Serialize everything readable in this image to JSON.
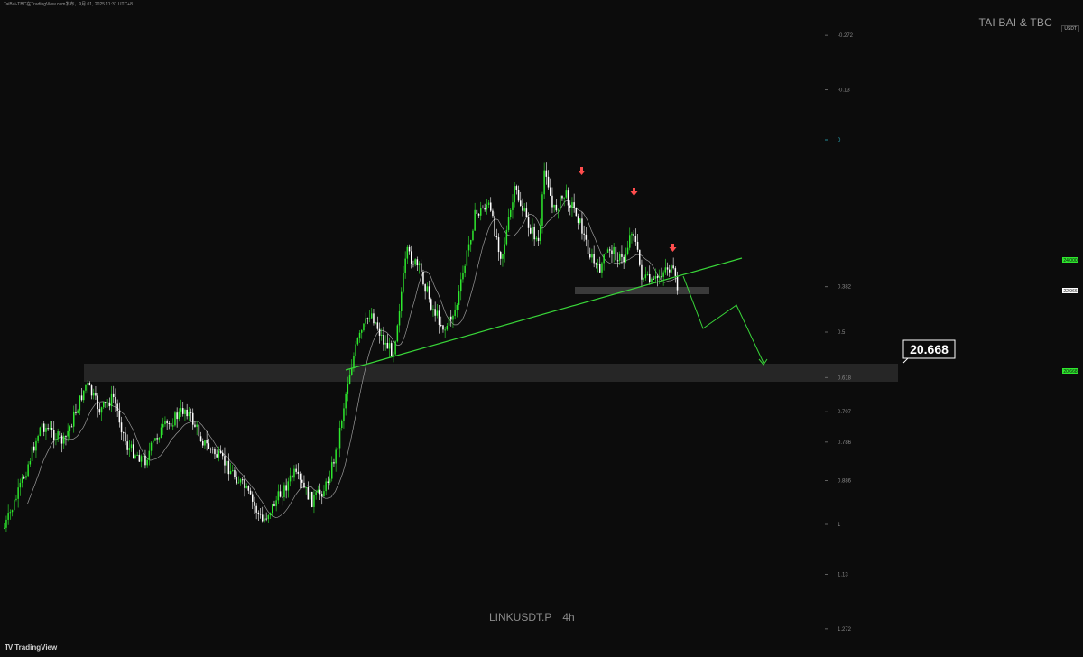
{
  "header_text": "TaiBai-TBC在TradingView.com发布，9月 01, 2025 11:31 UTC+8",
  "brand": "TAI BAI & TBC",
  "axis_currency": "USDT",
  "symbol": "LINKUSDT.P",
  "timeframe": "4h",
  "footer_logo": "TradingView",
  "colors": {
    "background": "#0c0c0c",
    "bull_candle": "#2ee82e",
    "bear_candle": "#ffffff",
    "trendline": "#39d639",
    "arrow": "#ff4d4d",
    "zone": "#2a2a2a"
  },
  "chart_data": {
    "type": "candlestick",
    "fib_levels": [
      {
        "label": "-0.272",
        "value": -0.272
      },
      {
        "label": "-0.13",
        "value": -0.13
      },
      {
        "label": "0",
        "value": 0
      },
      {
        "label": "0.382",
        "value": 0.382
      },
      {
        "label": "0.5",
        "value": 0.5
      },
      {
        "label": "0.618",
        "value": 0.618
      },
      {
        "label": "0.707",
        "value": 0.707
      },
      {
        "label": "0.786",
        "value": 0.786
      },
      {
        "label": "0.886",
        "value": 0.886
      },
      {
        "label": "1",
        "value": 1
      },
      {
        "label": "1.13",
        "value": 1.13
      },
      {
        "label": "1.272",
        "value": 1.272
      }
    ],
    "target_label": "20.668",
    "price_badges": [
      {
        "label": "24.000",
        "color": "#2ee82e"
      },
      {
        "label": "22.966",
        "color": "#ffffff"
      },
      {
        "label": "20.668",
        "color": "#2ee82e"
      }
    ],
    "annotations": [
      "three sell arrows at lower highs",
      "rising support trendline",
      "projected drop path to 20.668"
    ]
  }
}
